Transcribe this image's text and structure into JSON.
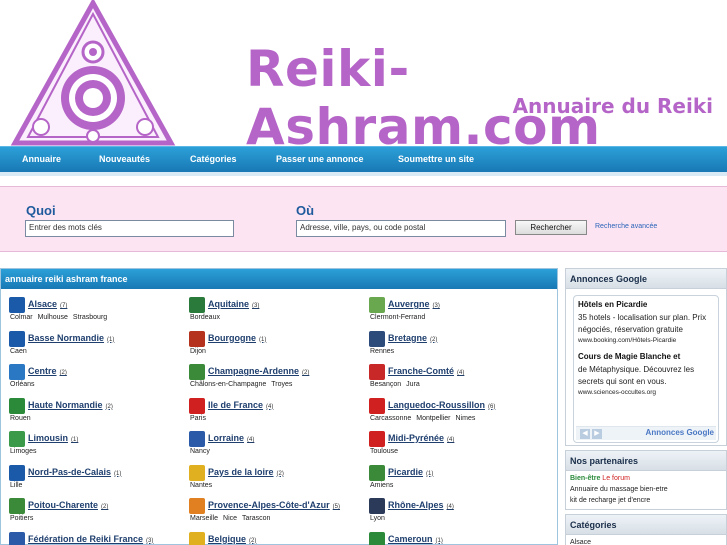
{
  "header": {
    "site_title": "Reiki-Ashram.com",
    "subtitle": "Annuaire du Reiki"
  },
  "nav": [
    "Annuaire",
    "Nouveautés",
    "Catégories",
    "Passer une annonce",
    "Soumettre un site"
  ],
  "search": {
    "what_label": "Quoi",
    "what_placeholder": "Entrer des mots clés",
    "where_label": "Où",
    "where_placeholder": "Adresse, ville, pays, ou code postal",
    "button": "Rechercher",
    "advanced": "Recherche avancée"
  },
  "main": {
    "title": "annuaire reiki ashram france",
    "regions": [
      {
        "name": "Alsace",
        "count": "(7)",
        "cities": [
          "Colmar",
          "Mulhouse",
          "Strasbourg"
        ],
        "color": "#1a5aa8"
      },
      {
        "name": "Aquitaine",
        "count": "(3)",
        "cities": [
          "Bordeaux"
        ],
        "color": "#2a7a3c"
      },
      {
        "name": "Auvergne",
        "count": "(3)",
        "cities": [
          "Clermont-Ferrand"
        ],
        "color": "#6aa84f"
      },
      {
        "name": "Basse Normandie",
        "count": "(1)",
        "cities": [
          "Caen"
        ],
        "color": "#1a5aa8"
      },
      {
        "name": "Bourgogne",
        "count": "(1)",
        "cities": [
          "Dijon"
        ],
        "color": "#b5321e"
      },
      {
        "name": "Bretagne",
        "count": "(2)",
        "cities": [
          "Rennes"
        ],
        "color": "#2c4a7a"
      },
      {
        "name": "Centre",
        "count": "(2)",
        "cities": [
          "Orléans"
        ],
        "color": "#2a78c4"
      },
      {
        "name": "Champagne-Ardenne",
        "count": "(2)",
        "cities": [
          "Châlons-en-Champagne",
          "Troyes"
        ],
        "color": "#3a8a3a"
      },
      {
        "name": "Franche-Comté",
        "count": "(4)",
        "cities": [
          "Besançon",
          "Jura"
        ],
        "color": "#c82828"
      },
      {
        "name": "Haute Normandie",
        "count": "(2)",
        "cities": [
          "Rouen"
        ],
        "color": "#2a8a3a"
      },
      {
        "name": "Ile de France",
        "count": "(4)",
        "cities": [
          "Paris"
        ],
        "color": "#d02020"
      },
      {
        "name": "Languedoc-Roussillon",
        "count": "(6)",
        "cities": [
          "Carcassonne",
          "Montpellier",
          "Nimes"
        ],
        "color": "#d02020"
      },
      {
        "name": "Limousin",
        "count": "(1)",
        "cities": [
          "Limoges"
        ],
        "color": "#3a9a4a"
      },
      {
        "name": "Lorraine",
        "count": "(4)",
        "cities": [
          "Nancy"
        ],
        "color": "#2a5aa8"
      },
      {
        "name": "Midi-Pyrénée",
        "count": "(4)",
        "cities": [
          "Toulouse"
        ],
        "color": "#d02020"
      },
      {
        "name": "Nord-Pas-de-Calais",
        "count": "(1)",
        "cities": [
          "Lille"
        ],
        "color": "#1a5aa8"
      },
      {
        "name": "Pays de la loire",
        "count": "(2)",
        "cities": [
          "Nantes"
        ],
        "color": "#e0b020"
      },
      {
        "name": "Picardie",
        "count": "(1)",
        "cities": [
          "Amiens"
        ],
        "color": "#3a8a3a"
      },
      {
        "name": "Poitou-Charente",
        "count": "(2)",
        "cities": [
          "Poitiers"
        ],
        "color": "#3a8a3a"
      },
      {
        "name": "Provence-Alpes-Côte-d'Azur",
        "count": "(5)",
        "cities": [
          "Marseille",
          "Nice",
          "Tarascon"
        ],
        "color": "#e08020"
      },
      {
        "name": "Rhône-Alpes",
        "count": "(4)",
        "cities": [
          "Lyon"
        ],
        "color": "#2c3a5a"
      },
      {
        "name": "Fédération de Reiki France",
        "count": "(3)",
        "cities": [],
        "color": "#2a5aa8"
      },
      {
        "name": "Belgique",
        "count": "(2)",
        "cities": [],
        "color": "#e0b020"
      },
      {
        "name": "Cameroun",
        "count": "(1)",
        "cities": [],
        "color": "#2a8a3a"
      }
    ]
  },
  "sidebar": {
    "ads_title": "Annonces Google",
    "ads": [
      {
        "title": "Hôtels en Picardie",
        "text": "35 hotels - localisation sur plan. Prix négociés, réservation gratuite",
        "url": "www.booking.com/Hôtels-Picardie"
      },
      {
        "title": "Cours de Magie Blanche et",
        "text": "de Métaphysique. Découvrez les secrets qui sont en vous.",
        "url": "www.sciences-occultes.org"
      }
    ],
    "ads_footer": "Annonces Google",
    "partners_title": "Nos partenaires",
    "partners_line1_a": "Bien-être",
    "partners_line1_b": "Le forum",
    "partners_line2": "Annuaire du massage bien-etre",
    "partners_line3": "kit de recharge jet d'encre",
    "categories_title": "Catégories",
    "categories_first": "Alsace"
  }
}
